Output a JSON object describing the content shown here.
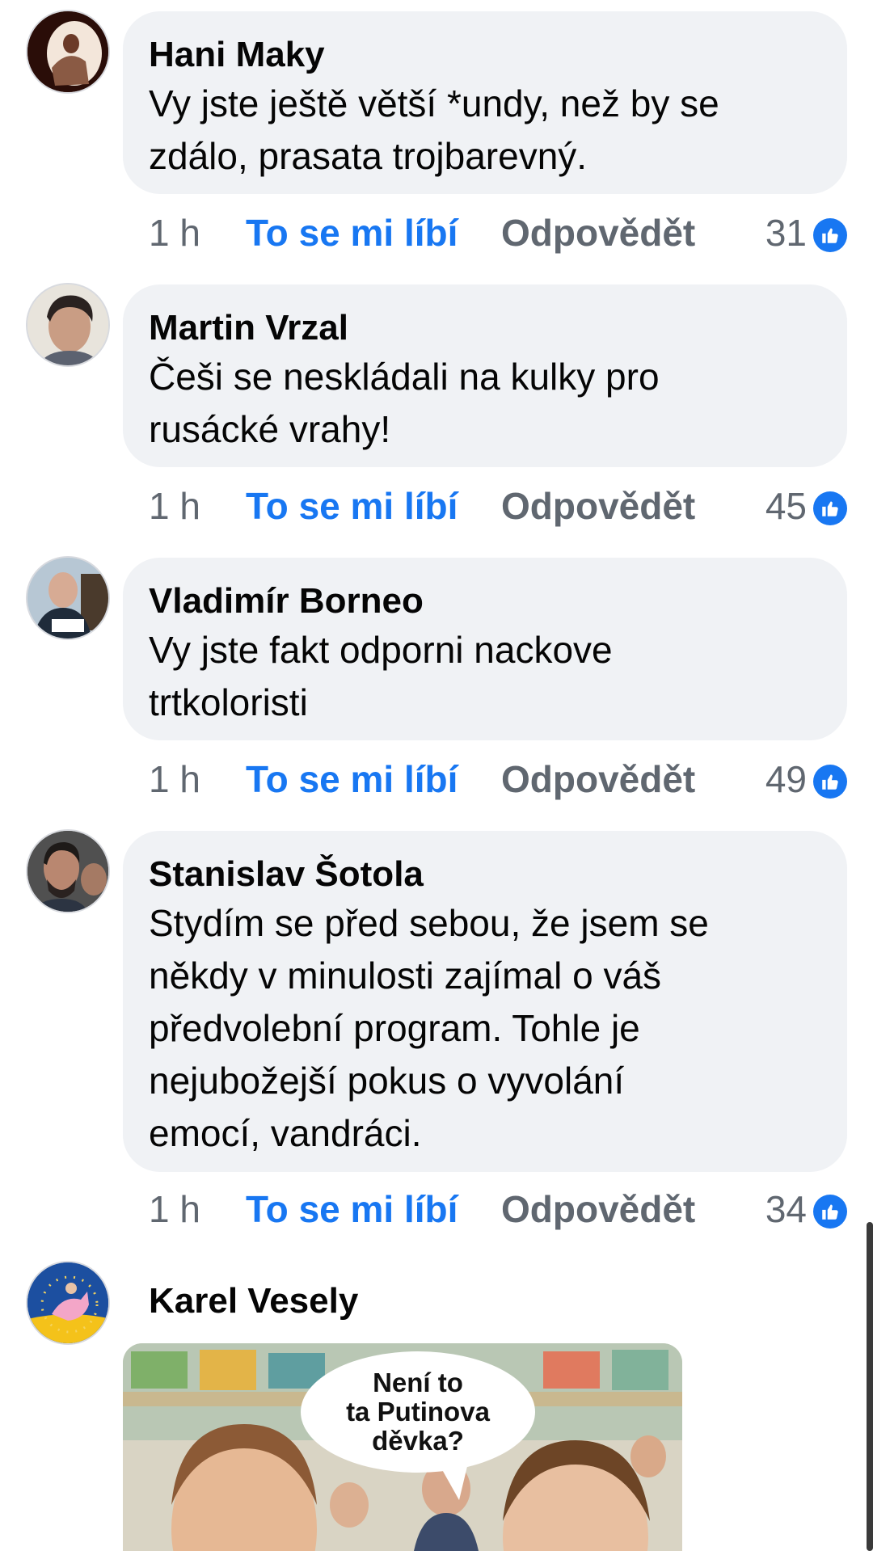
{
  "comments": [
    {
      "author": "Hani Maky",
      "text_lines": [
        "Vy jste ještě větší *undy, než by se",
        "zdálo, prasata trojbarevný."
      ],
      "time": "1 h",
      "like_label": "To se mi líbí",
      "reply_label": "Odpovědět",
      "reactions": "31"
    },
    {
      "author": "Martin Vrzal",
      "text_lines": [
        "Češi se neskládali na kulky pro",
        "rusácké vrahy!"
      ],
      "time": "1 h",
      "like_label": "To se mi líbí",
      "reply_label": "Odpovědět",
      "reactions": "45"
    },
    {
      "author": "Vladimír Borneo",
      "text_lines": [
        "Vy jste fakt odporni nackove",
        "trtkoloristi"
      ],
      "time": "1 h",
      "like_label": "To se mi líbí",
      "reply_label": "Odpovědět",
      "reactions": "49"
    },
    {
      "author": "Stanislav Šotola",
      "text_lines": [
        "Stydím se před sebou, že jsem se",
        "někdy v minulosti zajímal o váš",
        "předvolební program. Tohle je",
        "nejubožejší pokus o vyvolání",
        "emocí, vandráci."
      ],
      "time": "1 h",
      "like_label": "To se mi líbí",
      "reply_label": "Odpovědět",
      "reactions": "34"
    },
    {
      "author": "Karel Vesely",
      "meme_lines": [
        "Není to",
        "ta Putinova",
        "děvka?"
      ]
    }
  ],
  "colors": {
    "bubble_bg": "#f0f2f5",
    "like_blue": "#1877f2",
    "meta_gray": "#606770"
  },
  "icons": {
    "reaction": "like-thumb-icon"
  }
}
